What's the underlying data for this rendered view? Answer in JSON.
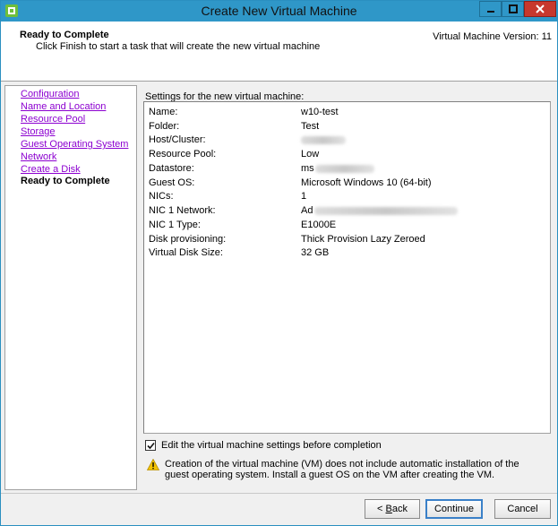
{
  "window": {
    "title": "Create New Virtual Machine"
  },
  "header": {
    "title": "Ready to Complete",
    "subtitle": "Click Finish to start a task that will create the new virtual machine",
    "version": "Virtual Machine Version: 11"
  },
  "nav": {
    "items": [
      {
        "label": "Configuration",
        "state": "visited"
      },
      {
        "label": "Name and Location",
        "state": "visited"
      },
      {
        "label": "Resource Pool",
        "state": "visited"
      },
      {
        "label": "Storage",
        "state": "visited"
      },
      {
        "label": "Guest Operating System",
        "state": "visited"
      },
      {
        "label": "Network",
        "state": "visited"
      },
      {
        "label": "Create a Disk",
        "state": "visited"
      },
      {
        "label": "Ready to Complete",
        "state": "current"
      }
    ]
  },
  "settings": {
    "heading": "Settings for the new virtual machine:",
    "rows": [
      {
        "key": "Name:",
        "value": "w10-test"
      },
      {
        "key": "Folder:",
        "value": "Test"
      },
      {
        "key": "Host/Cluster:",
        "value": ""
      },
      {
        "key": "Resource Pool:",
        "value": "Low"
      },
      {
        "key": "Datastore:",
        "value": "ms"
      },
      {
        "key": "Guest OS:",
        "value": "Microsoft Windows 10 (64-bit)"
      },
      {
        "key": "NICs:",
        "value": "1"
      },
      {
        "key": "NIC 1 Network:",
        "value": "Ad"
      },
      {
        "key": "NIC 1 Type:",
        "value": "E1000E"
      },
      {
        "key": "Disk provisioning:",
        "value": "Thick Provision Lazy Zeroed"
      },
      {
        "key": "Virtual Disk Size:",
        "value": "32 GB"
      }
    ]
  },
  "options": {
    "edit_before_completion": {
      "label": "Edit the virtual machine settings before completion",
      "checked": true
    }
  },
  "warning": {
    "text": "Creation of the virtual machine (VM) does not include automatic installation of the guest operating system. Install a guest OS on the VM after creating the VM."
  },
  "buttons": {
    "back_mnemonic": "B",
    "back_rest": "ack",
    "back_prefix": "< ",
    "continue": "Continue",
    "cancel": "Cancel"
  },
  "colors": {
    "titlebar": "#2f97c8",
    "close": "#c7382d",
    "visited_link": "#8c00d0"
  }
}
